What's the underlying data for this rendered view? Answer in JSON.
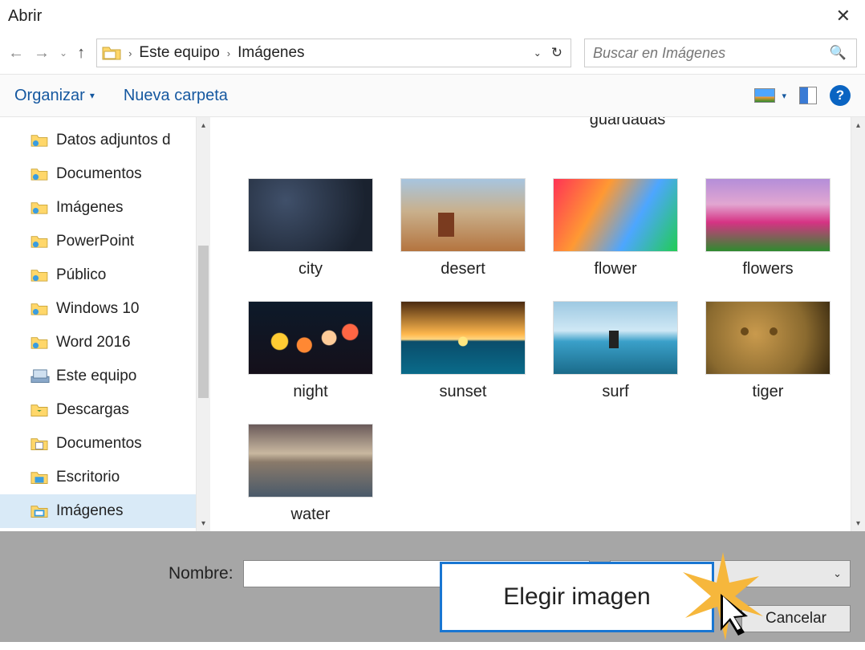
{
  "window": {
    "title": "Abrir"
  },
  "breadcrumb": {
    "seg1": "Este equipo",
    "seg2": "Imágenes"
  },
  "search": {
    "placeholder": "Buscar en Imágenes"
  },
  "toolbar": {
    "organize": "Organizar",
    "newfolder": "Nueva carpeta"
  },
  "content_top_label": "guardadas",
  "sidebar": {
    "items": [
      {
        "label": "Datos adjuntos d"
      },
      {
        "label": "Documentos"
      },
      {
        "label": "Imágenes"
      },
      {
        "label": "PowerPoint"
      },
      {
        "label": "Público"
      },
      {
        "label": "Windows 10"
      },
      {
        "label": "Word 2016"
      }
    ],
    "pc_header": "Este equipo",
    "pc_items": [
      {
        "label": "Descargas"
      },
      {
        "label": "Documentos"
      },
      {
        "label": "Escritorio"
      },
      {
        "label": "Imágenes"
      }
    ]
  },
  "files": [
    {
      "label": "city"
    },
    {
      "label": "desert"
    },
    {
      "label": "flower"
    },
    {
      "label": "flowers"
    },
    {
      "label": "night"
    },
    {
      "label": "sunset"
    },
    {
      "label": "surf"
    },
    {
      "label": "tiger"
    },
    {
      "label": "water"
    }
  ],
  "bottom": {
    "name_label": "Nombre:",
    "cancel": "Cancelar",
    "tooltip": "Elegir imagen"
  }
}
